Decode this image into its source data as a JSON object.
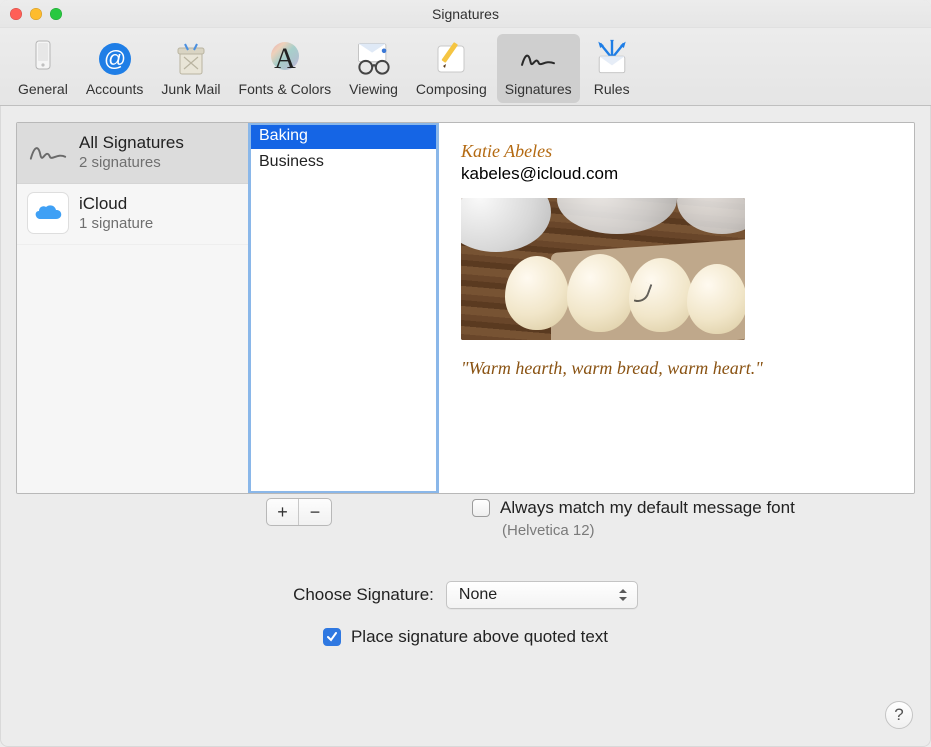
{
  "window": {
    "title": "Signatures"
  },
  "toolbar": {
    "items": [
      {
        "label": "General"
      },
      {
        "label": "Accounts"
      },
      {
        "label": "Junk Mail"
      },
      {
        "label": "Fonts & Colors"
      },
      {
        "label": "Viewing"
      },
      {
        "label": "Composing"
      },
      {
        "label": "Signatures"
      },
      {
        "label": "Rules"
      }
    ]
  },
  "accounts": [
    {
      "title": "All Signatures",
      "sub": "2 signatures"
    },
    {
      "title": "iCloud",
      "sub": "1 signature"
    }
  ],
  "signatures": [
    {
      "name": "Baking"
    },
    {
      "name": "Business"
    }
  ],
  "preview": {
    "name": "Katie Abeles",
    "email": "kabeles@icloud.com",
    "quote": "\"Warm hearth, warm bread, warm heart.\""
  },
  "buttons": {
    "add": "+",
    "remove": "−",
    "help": "?"
  },
  "options": {
    "match_label": "Always match my default message font",
    "match_sub": "(Helvetica 12)",
    "choose_label": "Choose Signature:",
    "choose_value": "None",
    "place_label": "Place signature above quoted text",
    "place_checked": true,
    "match_checked": false
  }
}
